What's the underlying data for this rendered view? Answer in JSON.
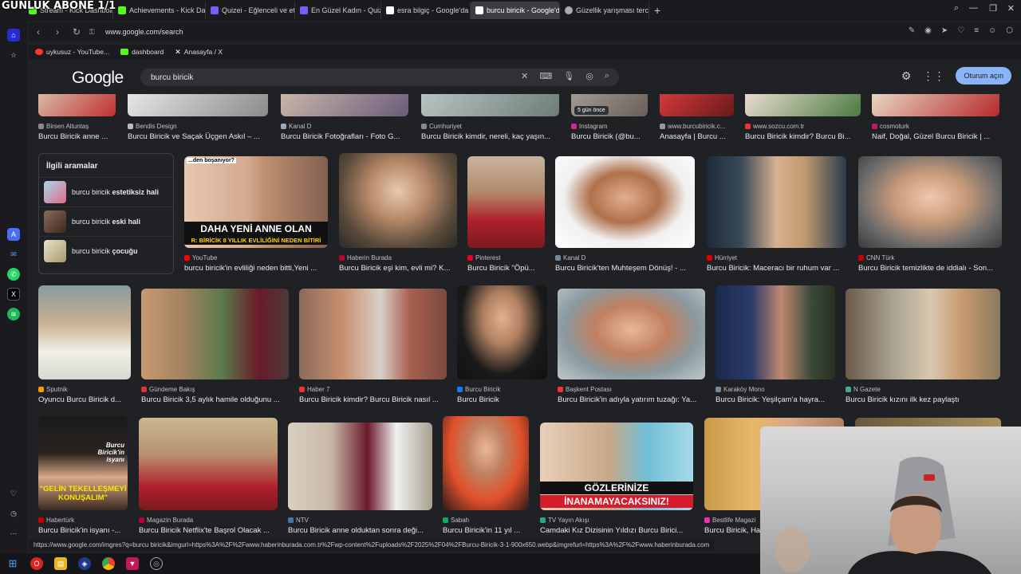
{
  "overlay_text": "GÜNLÜK ABONE 1/1",
  "tabs": [
    {
      "label": "Stream - Kick Dashboard",
      "color": "#53fc18",
      "active": false
    },
    {
      "label": "Achievements - Kick Dash",
      "color": "#53fc18",
      "active": false
    },
    {
      "label": "Quizei - Eğlenceli ve etkile",
      "color": "#7b5cff",
      "active": false
    },
    {
      "label": "En Güzel Kadın - Quizei",
      "color": "#7b5cff",
      "active": false
    },
    {
      "label": "esra bilgiç - Google'da Ar",
      "color": "#ffffff",
      "active": false
    },
    {
      "label": "burcu biricik - Google'da",
      "color": "#ffffff",
      "active": true
    },
    {
      "label": "Güzellik yarışması tercihi",
      "color": "#aaaaaa",
      "active": false
    }
  ],
  "address": {
    "url": "www.google.com/search"
  },
  "bookmarks": [
    {
      "label": "uykusuz - YouTube...",
      "color": "#ff3333"
    },
    {
      "label": "dashboard",
      "color": "#53fc18"
    },
    {
      "label": "Anasayfa / X",
      "color": "#ffffff"
    }
  ],
  "google": {
    "logo": "Google",
    "query": "burcu biricik",
    "signin_label": "Oturum açın"
  },
  "related": {
    "heading": "İlgili aramalar",
    "items": [
      {
        "prefix": "burcu biricik ",
        "bold": "estetiksiz hali"
      },
      {
        "prefix": "burcu biricik ",
        "bold": "eski hali"
      },
      {
        "prefix": "burcu biricik ",
        "bold": "çocuğu"
      }
    ]
  },
  "row0": [
    {
      "source": "Birsen Altuntaş",
      "title": "Burcu Biricik anne ..."
    },
    {
      "source": "Bendis Design",
      "title": "Burcu Biricik ve Saçak Üçgen Askıl – ..."
    },
    {
      "source": "Kanal D",
      "title": "Burcu Biricik Fotoğrafları - Foto G..."
    },
    {
      "source": "Cumhuriyet",
      "title": "Burcu Biricik kimdir, nereli, kaç yaşın..."
    },
    {
      "source": "Instagram",
      "title": "Burcu Biricik (@bu...",
      "badge": "5 gün önce"
    },
    {
      "source": "www.burcubiricik.c...",
      "title": "Anasayfa | Burcu ..."
    },
    {
      "source": "www.sozcu.com.tr",
      "title": "Burcu Biricik kimdir? Burcu Bi..."
    },
    {
      "source": "cosmoturk",
      "title": "Naif, Doğal, Güzel Burcu Biricik | ..."
    }
  ],
  "row1": [
    {
      "source": "YouTube",
      "title": "burcu biricik'in evliliği neden bitti,Yeni ...",
      "overlay": "DAHA YENİ ANNE OLAN",
      "overlay2": "R: BİRİCİK 8 YILLIK EVLİLİĞİNİ NEDEN BİTİRİ",
      "overlay3": "...den boşanıyor?"
    },
    {
      "source": "Haberin Burada",
      "title": "Burcu Biricik eşi kim, evli mi? K..."
    },
    {
      "source": "Pinterest",
      "title": "Burcu Biricik \"Öpü..."
    },
    {
      "source": "Kanal D",
      "title": "Burcu Biricik'ten Muhteşem Dönüş! - ..."
    },
    {
      "source": "Hürriyet",
      "title": "Burcu Biricik: Maceracı bir ruhum var ..."
    },
    {
      "source": "CNN Türk",
      "title": "Burcu Biricik temizlikte de iddialı - Son..."
    }
  ],
  "row2": [
    {
      "source": "Sputnik",
      "title": "Oyuncu Burcu Biricik d..."
    },
    {
      "source": "Gündeme Bakış",
      "title": "Burcu Biricik 3,5 aylık hamile olduğunu ..."
    },
    {
      "source": "Haber 7",
      "title": "Burcu Biricik kimdir? Burcu Biricik nasıl ..."
    },
    {
      "source": "Burcu Biricik",
      "title": "Burcu Biricik"
    },
    {
      "source": "Başkent Postası",
      "title": "Burcu Biricik'in adıyla yatırım tuzağı: Ya..."
    },
    {
      "source": "Karaköy Mono",
      "title": "Burcu Biricik: Yeşilçam'a hayra..."
    },
    {
      "source": "N Gazete",
      "title": "Burcu Biricik kızını ilk kez paylaştı"
    }
  ],
  "row3": [
    {
      "source": "Habertürk",
      "title": "Burcu Biricik'in isyanı -...",
      "overlay": "\"GELİN TEKELLEŞMEYİ KONUŞALIM\"",
      "overlay2": "Burcu Biricik'in isyanı"
    },
    {
      "source": "Magazin Burada",
      "title": "Burcu Biricik Netflix'te Başrol Olacak ..."
    },
    {
      "source": "NTV",
      "title": "Burcu Biricik anne olduktan sonra deği..."
    },
    {
      "source": "Sabah",
      "title": "Burcu Biricik'in 11 yıl ..."
    },
    {
      "source": "TV Yayın Akışı",
      "title": "Camdaki Kız Dizisinin Yıldızı Burcu Birici...",
      "overlay": "GÖZLERİNİZE",
      "overlay2": "İNANAMAYACAKSINIZ!"
    },
    {
      "source": "Bestlife Magazi",
      "title": "Burcu Biricik, Ha..."
    }
  ],
  "status_url": "https://www.google.com/imgres?q=burcu biricik&imgurl=https%3A%2F%2Fwww.haberinburada.com.tr%2Fwp-content%2Fuploads%2F2025%2F04%2FBurcu-Biricik-3-1-900x650.webp&imgrefurl=https%3A%2F%2Fwww.haberinburada.com"
}
